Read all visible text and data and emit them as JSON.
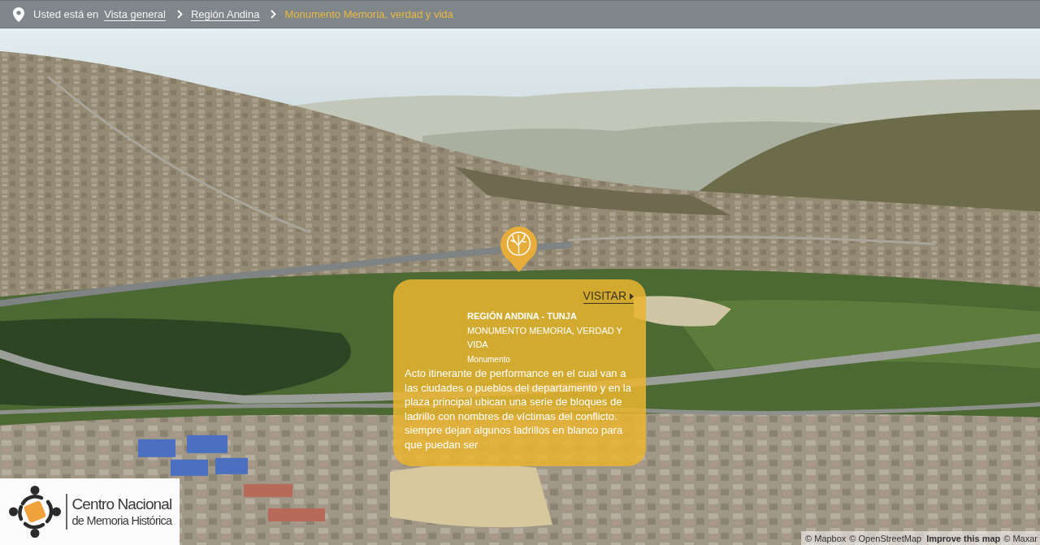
{
  "breadcrumb": {
    "prefix": "Usted está en",
    "items": [
      {
        "label": "Vista general",
        "current": false
      },
      {
        "label": "Región Andina",
        "current": false
      },
      {
        "label": "Monumento Memoria, verdad y vida",
        "current": true
      }
    ]
  },
  "popup": {
    "visit": "VISITAR",
    "region": "REGIÓN ANDINA - TUNJA",
    "title": "MONUMENTO MEMORIA, VERDAD Y VIDA",
    "type": "Monumento",
    "description": "Acto itinerante de performance en el cual van a las ciudades o pueblos del departamento y en la plaza principal ubican una serie de bloques de ladrillo con nombres de víctimas del conflicto. siempre dejan algunos ladrillos en blanco para que puedan ser"
  },
  "logo": {
    "line_1": "Centro Nacional",
    "line_2": "de Memoria Histórica"
  },
  "attribution": [
    {
      "label": "© Mapbox",
      "kind": "link"
    },
    {
      "label": "© OpenStreetMap",
      "kind": "link"
    },
    {
      "label": "Improve this map",
      "kind": "strong"
    },
    {
      "label": "© Maxar",
      "kind": "link"
    }
  ]
}
